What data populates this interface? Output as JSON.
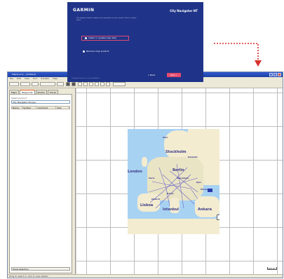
{
  "window": {
    "title": "MapSource - [Untitled]",
    "menu": [
      "File",
      "Edit",
      "View",
      "Find",
      "Transfer",
      "Help"
    ],
    "status": "Drag to select or click to view details"
  },
  "left_pane": {
    "tabs": [
      "Maps",
      "Waypoints",
      "Routes",
      "Tracks"
    ],
    "active_tab": "Waypoints",
    "product_label": "Select product:",
    "product_value": "City Navigator Europe",
    "columns": [
      "Name",
      "Symbol",
      "Comment",
      "Size"
    ],
    "footer_button": "Show Selection"
  },
  "map": {
    "cities": [
      "Lisboa",
      "Madrid",
      "Paris",
      "London",
      "Berlin",
      "Roma",
      "Warszawa",
      "Kyiv",
      "Istanbul",
      "Ankara",
      "Moskva",
      "Stockholm",
      "Oslo",
      "Helsinki"
    ],
    "scale_label": "200 km"
  },
  "dialog": {
    "brand": "GARMIN",
    "product": "City Navigator NT",
    "body": "This program installs or updates the map product on your computer. Select an option below.",
    "option_selected": "Install or update map data",
    "option_other": "Remove map product",
    "footer": "Copyright Garmin Ltd. or its subsidiaries",
    "back_button": "< Back",
    "next_button": "Next >"
  },
  "colors": {
    "dialog_bg": "#1f3488",
    "accent": "#e44a6d",
    "water": "#a8d2f2",
    "land": "#f3ecd0",
    "arrow": "#d9302a"
  }
}
